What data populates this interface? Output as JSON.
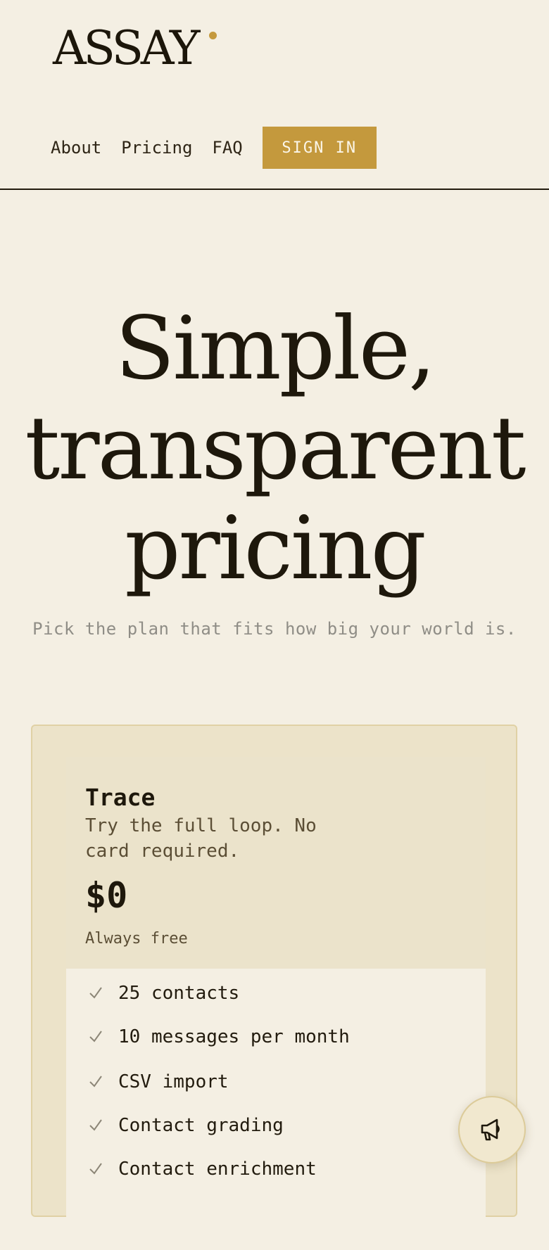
{
  "brand": {
    "logo_text": "ASSAY"
  },
  "nav": {
    "links": [
      "About",
      "Pricing",
      "FAQ"
    ],
    "signin_label": "SIGN IN"
  },
  "hero": {
    "title_lines": [
      "Simple,",
      "transparent",
      "pricing"
    ],
    "subtitle": "Pick the plan that fits how big your world is."
  },
  "plan": {
    "name": "Trace",
    "description": "Try the full loop. No card required.",
    "price": "$0",
    "price_note": "Always free",
    "features": [
      "25 contacts",
      "10 messages per month",
      "CSV import",
      "Contact grading",
      "Contact enrichment"
    ]
  },
  "fab": {
    "icon": "megaphone-icon"
  },
  "colors": {
    "accent": "#c4993d",
    "background": "#f4efe3",
    "text": "#221b0e",
    "card": "#ece3c9"
  }
}
